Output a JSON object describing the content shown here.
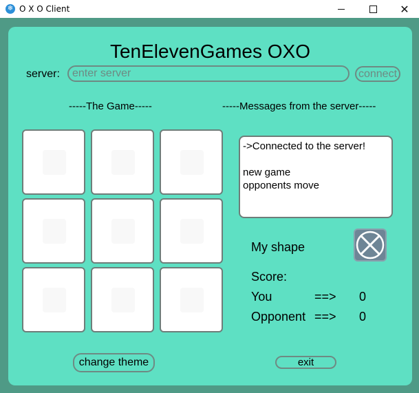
{
  "window": {
    "title": "O X O Client",
    "icon": "snowflake-icon",
    "minimize_icon": "minimize-icon",
    "maximize_icon": "maximize-icon",
    "close_glyph": "✕"
  },
  "game": {
    "title": "TenElevenGames OXO",
    "server_label": "server:",
    "server_placeholder": "enter server",
    "server_value": "",
    "connect_label": "connect",
    "game_header": "-----The Game-----",
    "messages_header": "-----Messages from the server-----",
    "board": [
      "",
      "",
      "",
      "",
      "",
      "",
      "",
      "",
      ""
    ],
    "messages": [
      "->Connected to the server!",
      "",
      "new game",
      "opponents move"
    ],
    "my_shape_label": "My shape",
    "my_shape": "X",
    "score_label": "Score:",
    "you_label": "You",
    "you_arrow": "==>",
    "you_score": "0",
    "opponent_label": "Opponent",
    "opponent_arrow": "==>",
    "opponent_score": "0",
    "change_theme_label": "change theme",
    "exit_label": "exit"
  },
  "colors": {
    "panel_background": "#5ee0c3",
    "window_background": "#4f9a86",
    "shape_tile": "#6e8596"
  }
}
